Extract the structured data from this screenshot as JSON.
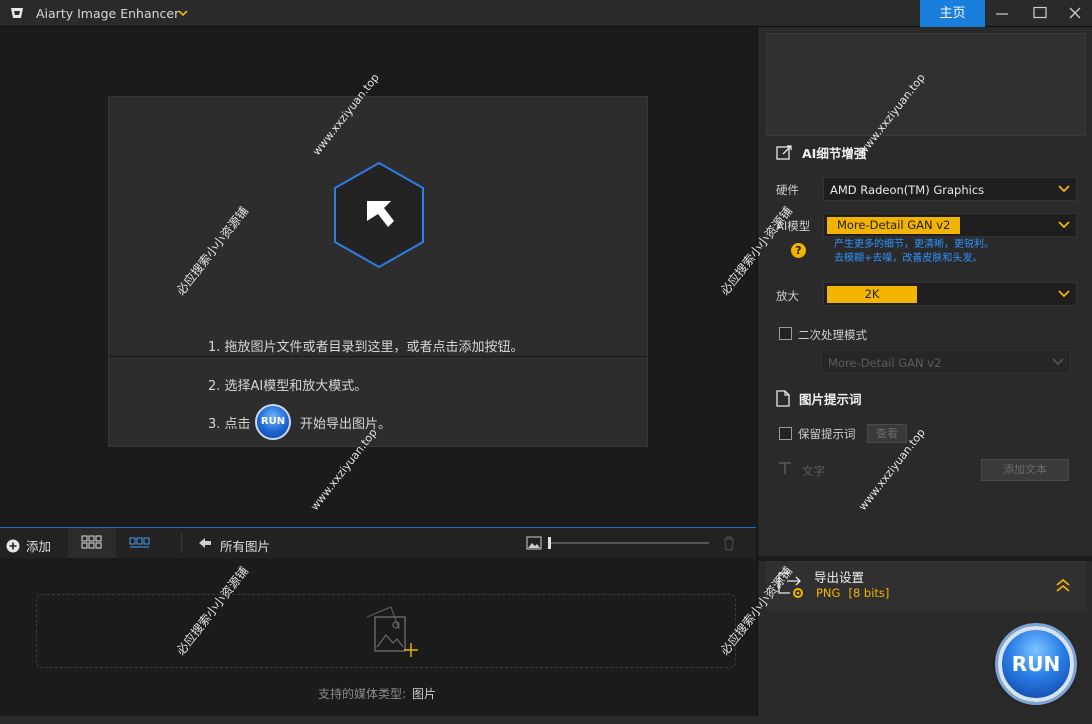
{
  "app": {
    "title": "Aiarty Image Enhancer",
    "home_label": "主页"
  },
  "drop_card": {
    "step1": "1. 拖放图片文件或者目录到这里，或者点击添加按钮。",
    "step2": "2. 选择AI模型和放大模式。",
    "step3_prefix": "3. 点击",
    "run_label": "RUN",
    "step3_suffix": "开始导出图片。"
  },
  "toolbar": {
    "add_label": "添加",
    "all_images_label": "所有图片"
  },
  "bottom": {
    "media_types_label": "支持的媒体类型:",
    "media_types_value": "图片"
  },
  "right_panel": {
    "ai_section_title": "AI细节增强",
    "hardware_label": "硬件",
    "hardware_value": "AMD Radeon(TM) Graphics",
    "model_label": "AI模型",
    "model_value": "More-Detail GAN v2",
    "model_desc_line1": "产生更多的细节，更清晰，更锐利。",
    "model_desc_line2": "去模糊+去噪，改善皮肤和头发。",
    "scale_label": "放大",
    "scale_value": "2K",
    "second_pass_label": "二次处理模式",
    "second_pass_model": "More-Detail GAN v2",
    "prompt_section_title": "图片提示词",
    "keep_prompt_label": "保留提示词",
    "view_button": "查看",
    "text_label": "文字",
    "add_text_button": "添加文本",
    "export_title": "导出设置",
    "export_format": "PNG",
    "export_bits": "[8 bits]",
    "run_label": "RUN"
  },
  "watermarks": {
    "site": "www.xxziyuan.top",
    "search": "必应搜索小小资源铺"
  },
  "colors": {
    "accent_blue": "#1a7fdc",
    "accent_yellow": "#f2b400",
    "link_blue": "#2f93ff"
  }
}
